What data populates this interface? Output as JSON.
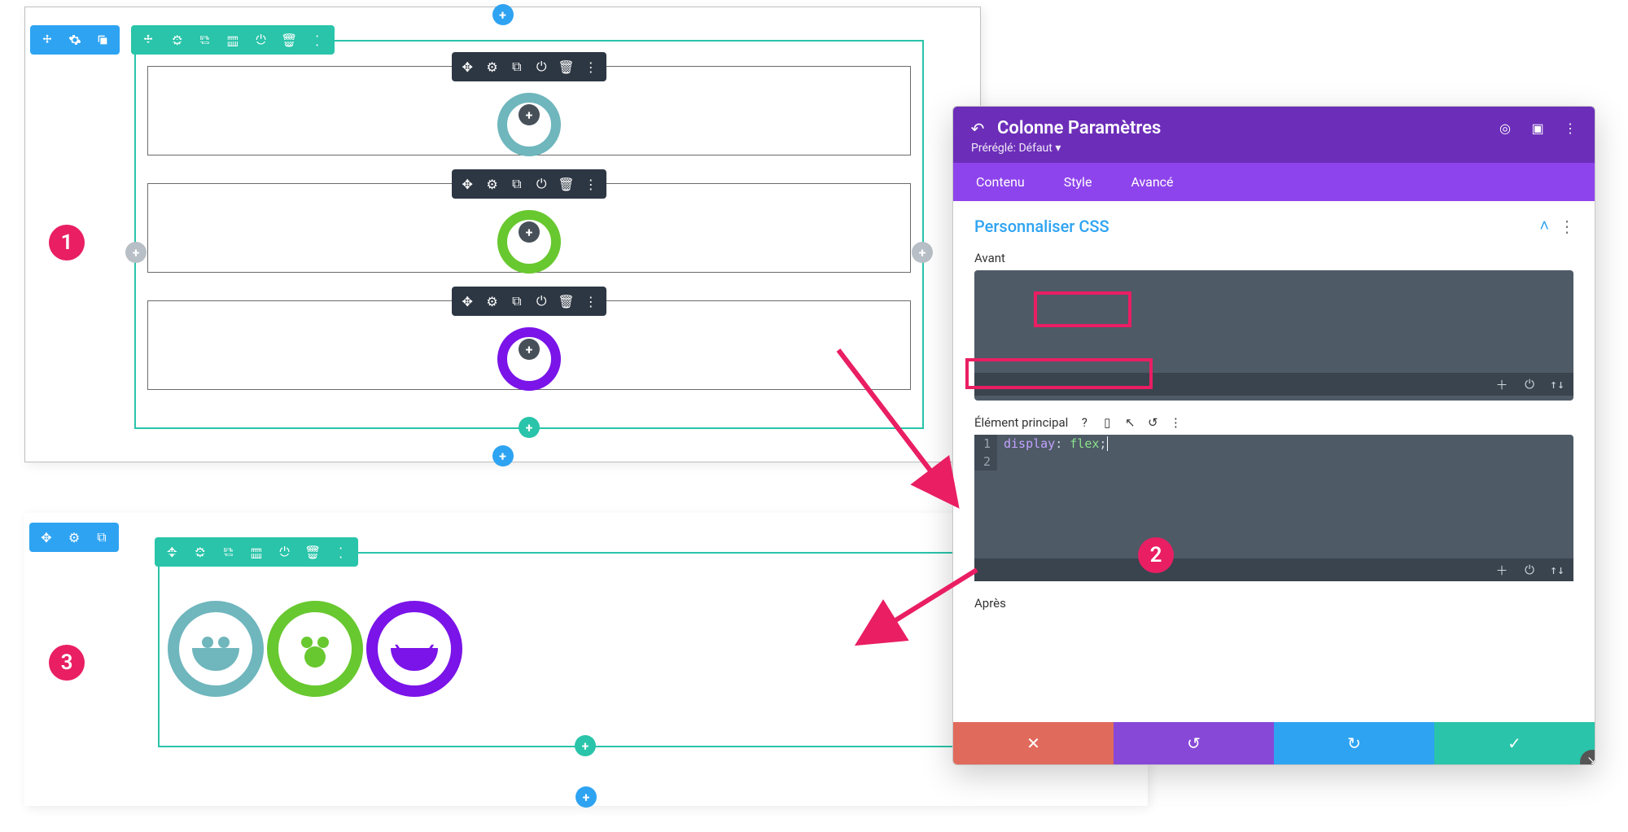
{
  "modal": {
    "title": "Colonne Paramètres",
    "preset": "Préréglé: Défaut ▾",
    "tabs": {
      "content": "Contenu",
      "style": "Style",
      "advanced": "Avancé"
    },
    "section_title": "Personnaliser CSS",
    "before_label": "Avant",
    "main_label": "Élément principal",
    "after_label": "Après",
    "code": {
      "line1_prop": "display",
      "line1_sep": ": ",
      "line1_val": "flex",
      "line1_end": ";"
    },
    "gutter": {
      "l1": "1",
      "l2": "2"
    }
  },
  "badges": {
    "one": "1",
    "two": "2",
    "three": "3"
  },
  "icons": {
    "move": "move-icon",
    "gear": "gear-icon",
    "dup": "duplicate-icon",
    "cols": "columns-icon",
    "power": "power-icon",
    "trash": "trash-icon",
    "dots": "dots-icon",
    "save": "save-icon",
    "undo": "undo-icon",
    "redo": "redo-icon",
    "close": "close-icon",
    "check": "check-icon",
    "help": "help-icon",
    "phone": "phone-icon",
    "cursor": "cursor-icon",
    "swap": "swap-icon",
    "expand": "expand-icon",
    "target": "target-icon",
    "layout": "layout-icon",
    "back": "back-icon"
  }
}
